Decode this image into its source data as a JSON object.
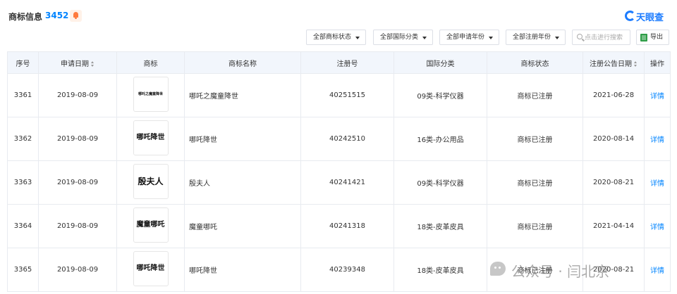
{
  "header": {
    "title": "商标信息",
    "count": "3452"
  },
  "logo": {
    "text": "天眼查"
  },
  "filters": {
    "status": "全部商标状态",
    "intl_class": "全部国际分类",
    "apply_year": "全部申请年份",
    "reg_year": "全部注册年份",
    "search_placeholder": "点击进行搜索",
    "export_label": "导出"
  },
  "table": {
    "headers": {
      "index": "序号",
      "apply_date": "申请日期",
      "trademark": "商标",
      "name": "商标名称",
      "reg_no": "注册号",
      "intl_class": "国际分类",
      "status": "商标状态",
      "announce_date": "注册公告日期",
      "action": "操作"
    },
    "rows": [
      {
        "index": "3361",
        "apply_date": "2019-08-09",
        "logo_text": "哪吒之魔童降世",
        "name": "哪吒之魔童降世",
        "reg_no": "40251515",
        "intl_class": "09类-科学仪器",
        "status": "商标已注册",
        "announce_date": "2021-06-28",
        "action": "详情"
      },
      {
        "index": "3362",
        "apply_date": "2019-08-09",
        "logo_text": "哪吒降世",
        "name": "哪吒降世",
        "reg_no": "40242510",
        "intl_class": "16类-办公用品",
        "status": "商标已注册",
        "announce_date": "2020-08-14",
        "action": "详情"
      },
      {
        "index": "3363",
        "apply_date": "2019-08-09",
        "logo_text": "殷夫人",
        "name": "殷夫人",
        "reg_no": "40241421",
        "intl_class": "09类-科学仪器",
        "status": "商标已注册",
        "announce_date": "2020-08-21",
        "action": "详情"
      },
      {
        "index": "3364",
        "apply_date": "2019-08-09",
        "logo_text": "魔童哪吒",
        "name": "魔童哪吒",
        "reg_no": "40241318",
        "intl_class": "18类-皮革皮具",
        "status": "商标已注册",
        "announce_date": "2021-04-14",
        "action": "详情"
      },
      {
        "index": "3365",
        "apply_date": "2019-08-09",
        "logo_text": "哪吒降世",
        "name": "哪吒降世",
        "reg_no": "40239348",
        "intl_class": "18类-皮革皮具",
        "status": "商标已注册",
        "announce_date": "2020-08-21",
        "action": "详情"
      }
    ]
  },
  "watermark": {
    "text": "公众号 · 闫北京"
  },
  "colors": {
    "accent": "#0084ff",
    "header_bg": "#f2f6fc",
    "border": "#e8ebf0",
    "bell": "#ff7a3d",
    "brand": "#1c7cff",
    "excel": "#2f9e48"
  }
}
